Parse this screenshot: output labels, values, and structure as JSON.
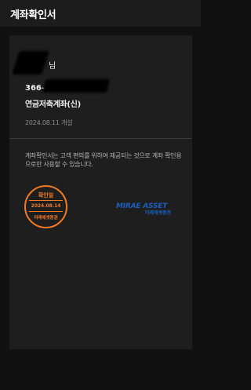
{
  "header": {
    "title": "계좌확인서"
  },
  "certificate": {
    "honorific": "님",
    "account_prefix": "366-",
    "account_type": "연금저축계좌(신)",
    "open_date": "2024.08.11 개설",
    "notice": "계좌확인서는 고객 편의를 위하여 제공되는 것으로 계좌 확인용으로만 사용할 수 있습니다.",
    "stamp": {
      "title": "확인일",
      "date": "2024.08.14",
      "issuer": "미래에셋증권"
    },
    "logo": {
      "brand_en": "MIRAE ASSET",
      "brand_kr": "미래에셋증권"
    }
  },
  "colors": {
    "background": "#111111",
    "card": "#1e1e1e",
    "stamp": "#f07a22",
    "brand_blue": "#1d5fbf"
  }
}
